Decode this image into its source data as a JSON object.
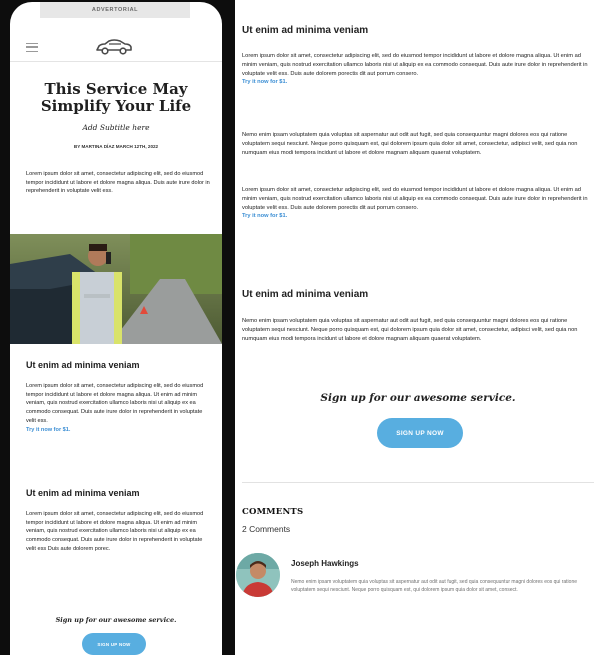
{
  "phone": {
    "advertorial_label": "ADVERTORIAL",
    "icons": {
      "menu": "hamburger-menu-icon",
      "logo": "car-logo-icon"
    },
    "article": {
      "title": "This Service May Simplify Your Life",
      "subtitle": "Add Subtitle here",
      "byline": "BY MARTINA DÍAZ MARCH 12TH, 2022",
      "intro": "Lorem ipsum dolor sit amet, consectetur adipiscing elit, sed do eiusmod tempor incididunt ut labore et dolore magna aliqua. Duis aute irure dolor in reprehenderit in voluptate velit ess.",
      "section1": {
        "heading": "Ut enim ad minima veniam",
        "body": "Lorem ipsum dolor sit amet, consectetur adipiscing elit, sed do eiusmod tempor incididunt ut labore et dolore magna aliqua. Ut enim ad minim veniam, quis nostrud exercitation ullamco laboris nisi ut aliquip ex ea commodo consequat. Duis aute irure dolor in reprehenderit in voluptate velit ess.",
        "link": "Try it now for $1."
      },
      "section2": {
        "heading": "Ut enim ad minima veniam",
        "body": "Lorem ipsum dolor sit amet, consectetur adipiscing elit, sed do eiusmod tempor incididunt ut labore et dolore magna aliqua. Ut enim ad minim veniam, quis nostrud exercitation ullamco laboris nisi ut aliquip ex ea commodo consequat. Duis aute irure dolor in reprehenderit in voluptate velit ess Duis aute dolorem porec."
      },
      "signup_text": "Sign up for our awesome service.",
      "signup_button": "SIGN UP NOW"
    }
  },
  "main": {
    "section1": {
      "heading": "Ut enim ad minima veniam",
      "body": "Lorem ipsum dolor sit amet, consectetur adipiscing elit, sed do eiusmod tempor incididunt ut labore et dolore magna aliqua. Ut enim ad minim veniam, quis nostrud exercitation ullamco laboris nisi ut aliquip ex ea commodo consequat. Duis aute irure dolor in reprehenderit in voluptate velit ess. Duis aute dolorem porectis dit aut porrum consero.",
      "link": "Try it now for $1."
    },
    "para2": "Nemo enim ipsam voluptatem quia voluptas sit aspernatur aut odit aut fugit, sed quia consequuntur magni dolores eos qui ratione voluptatem sequi nesciunt. Neque porro quisquam est, qui dolorem ipsum quia dolor sit amet, consectetur, adipisci velit, sed quia non numquam eius modi tempora incidunt ut labore et dolore magnam aliquam quaerat voluptatem.",
    "para3": "Lorem ipsum dolor sit amet, consectetur adipiscing elit, sed do eiusmod tempor incididunt ut labore et dolore magna aliqua. Ut enim ad minim veniam, quis nostrud exercitation ullamco laboris nisi ut aliquip ex ea commodo consequat. Duis aute irure dolor in reprehenderit in voluptate velit ess. Duis aute dolorem porectis dit aut porrum consero.",
    "para3_link": "Try it now for $1.",
    "section2": {
      "heading": "Ut enim ad minima veniam",
      "body": "Nemo enim ipsam voluptatem quia voluptas sit aspernatur aut odit aut fugit, sed quia consequuntur magni dolores eos qui ratione voluptatem sequi nesciunt. Neque porro quisquam est, qui dolorem ipsum quia dolor sit amet, consectetur, adipisci velit, sed quia non numquam eius modi tempora incidunt ut labore et dolore magnam aliquam quaerat voluptatem."
    },
    "signup_text": "Sign up for our awesome service.",
    "signup_button": "SIGN UP NOW",
    "comments": {
      "title": "COMMENTS",
      "count": "2 Comments",
      "items": [
        {
          "name": "Joseph Hawkings",
          "text": "Nemo enim ipsam voluptatem quia voluptas sit aspernatur aut odit aut fugit, sed quia consequuntur magni dolores eos qui ratione voluptatem sequi nesciunt. Neque porro quisquam est, qui dolorem ipsum quia dolor sit amet, consect."
        }
      ]
    }
  },
  "colors": {
    "accent": "#58aee0",
    "link": "#3b8ed4",
    "bezel": "#0d0d0d"
  }
}
